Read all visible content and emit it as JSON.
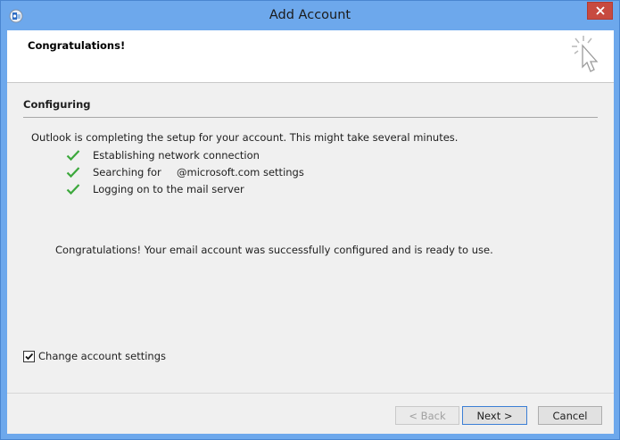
{
  "window": {
    "title": "Add Account"
  },
  "header": {
    "title": "Congratulations!"
  },
  "section": {
    "title": "Configuring",
    "intro": "Outlook is completing the setup for your account. This might take several minutes."
  },
  "steps": [
    {
      "label": "Establishing network connection",
      "suffix": ""
    },
    {
      "label": "Searching for",
      "suffix": "@microsoft.com settings"
    },
    {
      "label": "Logging on to the mail server",
      "suffix": ""
    }
  ],
  "success_message": "Congratulations! Your email account was successfully configured and is ready to use.",
  "options": {
    "change_settings_label": "Change account settings",
    "change_settings_checked": true
  },
  "buttons": {
    "back": "< Back",
    "next": "Next >",
    "cancel": "Cancel"
  },
  "colors": {
    "titlebar": "#6da8ec",
    "close": "#c74a40",
    "check": "#3ca83c"
  }
}
